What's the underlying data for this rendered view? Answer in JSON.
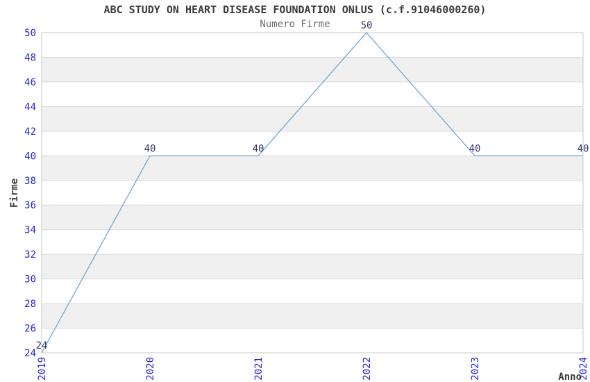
{
  "page": {
    "background": "#ffffff"
  },
  "chart_data": {
    "type": "line",
    "title": "ABC STUDY ON HEART DISEASE FOUNDATION ONLUS (c.f.91046000260)",
    "subtitle": "Numero Firme",
    "xlabel": "Anno",
    "ylabel": "Firme",
    "x": [
      "2019",
      "2020",
      "2021",
      "2022",
      "2023",
      "2024"
    ],
    "series": [
      {
        "name": "Numero Firme",
        "values": [
          24,
          40,
          40,
          50,
          40,
          40
        ]
      }
    ],
    "ylim": [
      24,
      50
    ],
    "ytick_step": 2,
    "yticks": [
      24,
      26,
      28,
      30,
      32,
      34,
      36,
      38,
      40,
      42,
      44,
      46,
      48,
      50
    ],
    "grid": "horizontal",
    "alternating_bands": true,
    "legend": "none",
    "point_labels_visible": true,
    "colors": {
      "line": "#64a1d8",
      "point_label": "#333366",
      "tick_label": "#2525cd",
      "title": "#3c3c3c",
      "subtitle": "#6e6e6e",
      "axis_label": "#3c3c3c",
      "band": "#f0f0f0",
      "gridline": "#d9d9d9",
      "border": "#c9c9c9"
    }
  }
}
